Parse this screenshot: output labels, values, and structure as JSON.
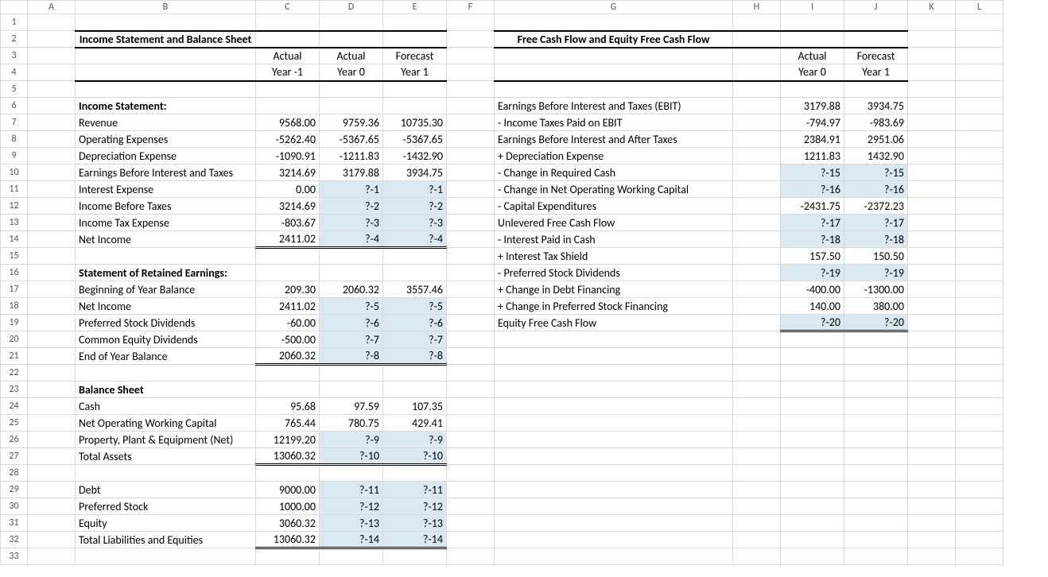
{
  "cols": [
    "A",
    "B",
    "C",
    "D",
    "E",
    "F",
    "G",
    "H",
    "I",
    "J",
    "K",
    "L"
  ],
  "left": {
    "title": "Income Statement and Balance Sheet",
    "hdr1": {
      "c": "Actual",
      "d": "Actual",
      "e": "Forecast"
    },
    "hdr2": {
      "c": "Year -1",
      "d": "Year 0",
      "e": "Year 1"
    },
    "inc_title": "Income Statement:",
    "rev": {
      "lbl": "Revenue",
      "c": "9568.00",
      "d": "9759.36",
      "e": "10735.30"
    },
    "opex": {
      "lbl": "Operating Expenses",
      "c": "-5262.40",
      "d": "-5367.65",
      "e": "-5367.65"
    },
    "dep": {
      "lbl": "Depreciation Expense",
      "c": "-1090.91",
      "d": "-1211.83",
      "e": "-1432.90"
    },
    "ebit": {
      "lbl": "Earnings Before Interest and Taxes",
      "c": "3214.69",
      "d": "3179.88",
      "e": "3934.75"
    },
    "intexp": {
      "lbl": "Interest Expense",
      "c": "0.00",
      "d": "?-1",
      "e": "?-1"
    },
    "ibt": {
      "lbl": "Income Before Taxes",
      "c": "3214.69",
      "d": "?-2",
      "e": "?-2"
    },
    "tax": {
      "lbl": "Income Tax Expense",
      "c": "-803.67",
      "d": "?-3",
      "e": "?-3"
    },
    "ni": {
      "lbl": "Net Income",
      "c": "2411.02",
      "d": "?-4",
      "e": "?-4"
    },
    "re_title": "Statement of Retained Earnings:",
    "boybal": {
      "lbl": "Beginning of Year Balance",
      "c": "209.30",
      "d": "2060.32",
      "e": "3557.46"
    },
    "ni2": {
      "lbl": "Net Income",
      "c": "2411.02",
      "d": "?-5",
      "e": "?-5"
    },
    "pref": {
      "lbl": "Preferred Stock Dividends",
      "c": "-60.00",
      "d": "?-6",
      "e": "?-6"
    },
    "commdiv": {
      "lbl": "Common Equity Dividends",
      "c": "-500.00",
      "d": "?-7",
      "e": "?-7"
    },
    "eoy": {
      "lbl": "End of Year Balance",
      "c": "2060.32",
      "d": "?-8",
      "e": "?-8"
    },
    "bs_title": "Balance Sheet",
    "cash": {
      "lbl": "Cash",
      "c": "95.68",
      "d": "97.59",
      "e": "107.35"
    },
    "nowc": {
      "lbl": "Net Operating Working Capital",
      "c": "765.44",
      "d": "780.75",
      "e": "429.41"
    },
    "ppe": {
      "lbl": "Property, Plant & Equipment (Net)",
      "c": "12199.20",
      "d": "?-9",
      "e": "?-9"
    },
    "ta": {
      "lbl": "Total Assets",
      "c": "13060.32",
      "d": "?-10",
      "e": "?-10"
    },
    "debt": {
      "lbl": "Debt",
      "c": "9000.00",
      "d": "?-11",
      "e": "?-11"
    },
    "pstock": {
      "lbl": "Preferred Stock",
      "c": "1000.00",
      "d": "?-12",
      "e": "?-12"
    },
    "equity": {
      "lbl": "Equity",
      "c": "3060.32",
      "d": "?-13",
      "e": "?-13"
    },
    "tle": {
      "lbl": "Total Liabilities and Equities",
      "c": "13060.32",
      "d": "?-14",
      "e": "?-14"
    }
  },
  "right": {
    "title": "Free Cash Flow and Equity Free Cash Flow",
    "hdr1": {
      "i": "Actual",
      "j": "Forecast"
    },
    "hdr2": {
      "i": "Year 0",
      "j": "Year 1"
    },
    "ebit": {
      "lbl": "Earnings Before Interest and Taxes (EBIT)",
      "i": "3179.88",
      "j": "3934.75"
    },
    "taxebit": {
      "lbl": "  - Income Taxes Paid on EBIT",
      "i": "-794.97",
      "j": "-983.69"
    },
    "ebiatt": {
      "lbl": "Earnings Before Interest and After Taxes",
      "i": "2384.91",
      "j": "2951.06"
    },
    "dep": {
      "lbl": "  + Depreciation Expense",
      "i": "1211.83",
      "j": "1432.90"
    },
    "reqcash": {
      "lbl": "  - Change in Required Cash",
      "i": "?-15",
      "j": "?-15"
    },
    "nowc": {
      "lbl": "  - Change in Net Operating Working Capital",
      "i": "?-16",
      "j": "?-16"
    },
    "capex": {
      "lbl": "  - Capital Expenditures",
      "i": "-2431.75",
      "j": "-2372.23"
    },
    "ufcf": {
      "lbl": "Unlevered Free Cash Flow",
      "i": "?-17",
      "j": "?-17"
    },
    "intpaid": {
      "lbl": "  - Interest Paid in Cash",
      "i": "?-18",
      "j": "?-18"
    },
    "its": {
      "lbl": "  + Interest Tax Shield",
      "i": "157.50",
      "j": "150.50"
    },
    "prefdiv": {
      "lbl": "  - Preferred Stock Dividends",
      "i": "?-19",
      "j": "?-19"
    },
    "chdebt": {
      "lbl": "  + Change in Debt Financing",
      "i": "-400.00",
      "j": "-1300.00"
    },
    "chpref": {
      "lbl": "  + Change in Preferred Stock Financing",
      "i": "140.00",
      "j": "380.00"
    },
    "efcf": {
      "lbl": "Equity Free Cash Flow",
      "i": "?-20",
      "j": "?-20"
    }
  }
}
